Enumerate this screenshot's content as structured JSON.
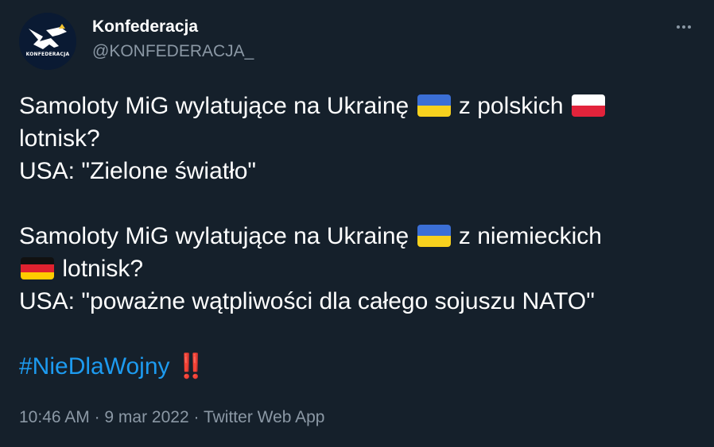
{
  "author": {
    "display_name": "Konfederacja",
    "handle": "@KONFEDERACJA_",
    "avatar_text": "KONFEDERACJA"
  },
  "tweet": {
    "p1": {
      "l1a": "Samoloty MiG wylatujące na Ukrainę",
      "flag_ua_1": "ukraine-flag",
      "l1b": "z polskich",
      "flag_pl": "poland-flag",
      "l2": "lotnisk?",
      "l3": "USA: \"Zielone światło\""
    },
    "p2": {
      "l1a": "Samoloty MiG wylatujące na Ukrainę",
      "flag_ua_2": "ukraine-flag",
      "l1b": "z niemieckich",
      "flag_de": "germany-flag",
      "l2": "lotnisk?",
      "l3": "USA: \"poważne wątpliwości dla całego sojuszu NATO\""
    },
    "hashtag": "#NieDlaWojny",
    "emphasis": "‼️"
  },
  "meta": {
    "time": "10:46 AM",
    "sep1": "·",
    "date": "9 mar 2022",
    "sep2": "·",
    "source": "Twitter Web App"
  },
  "colors": {
    "background": "#15202b",
    "text": "#ffffff",
    "muted": "#8b98a5",
    "link": "#1d9bf0",
    "emphasis": "#e0222f"
  }
}
